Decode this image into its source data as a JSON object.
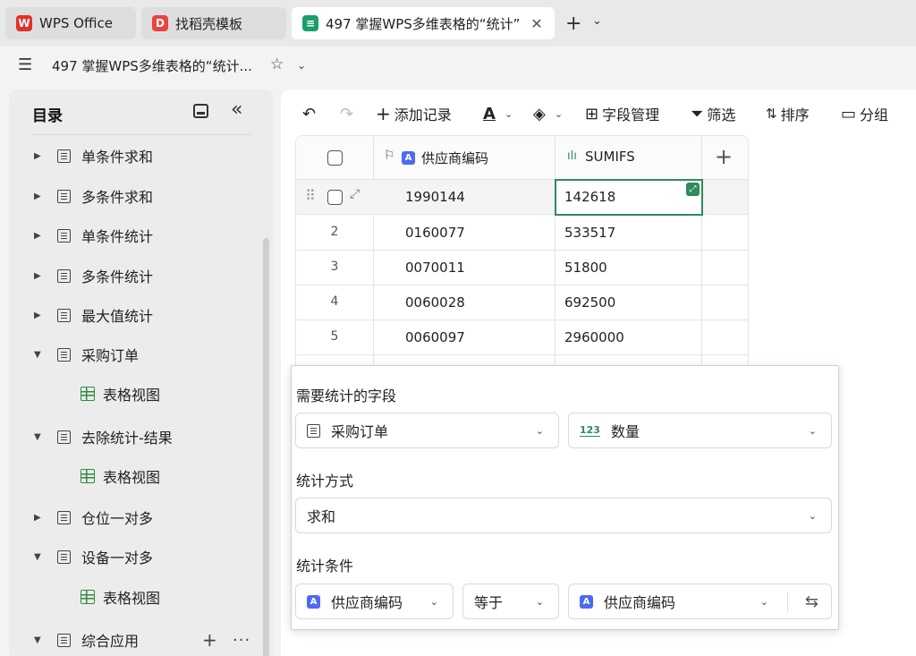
{
  "tabs": [
    {
      "label": "WPS Office",
      "icon": "wps-logo"
    },
    {
      "label": "找稻壳模板",
      "icon": "docer-logo"
    },
    {
      "label": "497 掌握WPS多维表格的“统计”",
      "icon": "dbsheet-logo",
      "active": true
    }
  ],
  "titlebar": {
    "doc_title": "497 掌握WPS多维表格的“统计..."
  },
  "sidebar": {
    "heading": "目录",
    "items": [
      {
        "label": "单条件求和",
        "expanded": false
      },
      {
        "label": "多条件求和",
        "expanded": false
      },
      {
        "label": "单条件统计",
        "expanded": false
      },
      {
        "label": "多条件统计",
        "expanded": false
      },
      {
        "label": "最大值统计",
        "expanded": false
      },
      {
        "label": "采购订单",
        "expanded": true
      },
      {
        "label": "表格视图",
        "sub": true
      },
      {
        "label": "去除统计-结果",
        "expanded": true
      },
      {
        "label": "表格视图",
        "sub": true
      },
      {
        "label": "仓位一对多",
        "expanded": false
      },
      {
        "label": "设备一对多",
        "expanded": true
      },
      {
        "label": "表格视图",
        "sub": true
      },
      {
        "label": "综合应用",
        "expanded": true
      }
    ]
  },
  "toolbar": {
    "add_record": "添加记录",
    "field_manage": "字段管理",
    "filter": "筛选",
    "sort": "排序",
    "group": "分组"
  },
  "grid": {
    "columns": [
      "供应商编码",
      "SUMIFS"
    ],
    "rows": [
      {
        "num": "",
        "code": "1990144",
        "sumifs": "142618"
      },
      {
        "num": "2",
        "code": "0160077",
        "sumifs": "533517"
      },
      {
        "num": "3",
        "code": "0070011",
        "sumifs": "51800"
      },
      {
        "num": "4",
        "code": "0060028",
        "sumifs": "692500"
      },
      {
        "num": "5",
        "code": "0060097",
        "sumifs": "2960000"
      }
    ]
  },
  "popup": {
    "field_label": "需要统计的字段",
    "table_select": "采购订单",
    "field_select": "数量",
    "num_icon_text": "123",
    "method_label": "统计方式",
    "method_select": "求和",
    "condition_label": "统计条件",
    "cond_field": "供应商编码",
    "cond_op": "等于",
    "cond_value": "供应商编码"
  },
  "colors": {
    "accent_green": "#2f8a5c",
    "field_blue": "#4e6af0",
    "wps_red": "#e0312b",
    "docer_red": "#e8453c",
    "dbsheet_green": "#1a9e6e"
  }
}
